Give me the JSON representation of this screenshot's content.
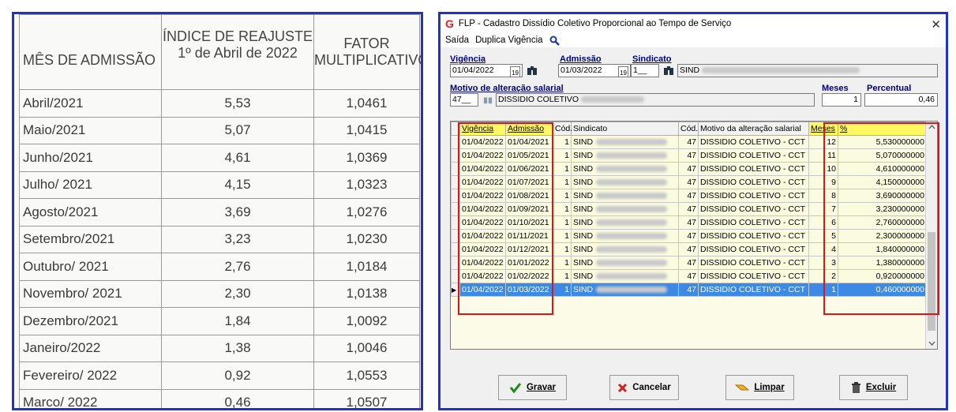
{
  "left_table": {
    "headers": [
      "MÊS DE ADMISSÃO",
      "ÍNDICE DE REAJUSTE\n1º de Abril de 2022",
      "FATOR\nMULTIPLICATIVO"
    ],
    "rows": [
      [
        "Abril/2021",
        "5,53",
        "1,0461"
      ],
      [
        "Maio/2021",
        "5,07",
        "1,0415"
      ],
      [
        "Junho/2021",
        "4,61",
        "1,0369"
      ],
      [
        "Julho/ 2021",
        "4,15",
        "1,0323"
      ],
      [
        "Agosto/2021",
        "3,69",
        "1,0276"
      ],
      [
        "Setembro/2021",
        "3,23",
        "1,0230"
      ],
      [
        "Outubro/ 2021",
        "2,76",
        "1,0184"
      ],
      [
        "Novembro/ 2021",
        "2,30",
        "1,0138"
      ],
      [
        "Dezembro/2021",
        "1,84",
        "1,0092"
      ],
      [
        "Janeiro/2022",
        "1,38",
        "1,0046"
      ],
      [
        "Fevereiro/ 2022",
        "0,92",
        "1,0553"
      ],
      [
        "Marco/ 2022",
        "0,46",
        "1,0507"
      ]
    ]
  },
  "window": {
    "title": "FLP - Cadastro Dissídio Coletivo Proporcional ao Tempo de Serviço",
    "app_icon": "G",
    "close_icon": "✕",
    "menu": {
      "saida": "Saída",
      "duplica": "Duplica Vigência",
      "search_icon": "search-icon"
    },
    "vigencia_label": "Vigência",
    "vigencia_value": "01/04/2022",
    "admissao_label": "Admissão",
    "admissao_value": "01/03/2022",
    "sindicato_label": "Sindicato",
    "sindicato_code": "1__",
    "sindicato_name": "SIND",
    "motivo_label": "Motivo de alteração salarial",
    "motivo_code": "47__",
    "motivo_name": "DISSIDIO COLETIVO",
    "meses_label": "Meses",
    "meses_value": "1",
    "percentual_label": "Percentual",
    "percentual_value": "0,46",
    "calendar_icon": "19",
    "binoculars_icon": "binoculars-icon"
  },
  "grid": {
    "columns": [
      "Vigência",
      "Admissão",
      "Cód.",
      "Sindicato",
      "Cód.",
      "Motivo da alteração salarial",
      "Meses",
      "%"
    ],
    "rows": [
      [
        "01/04/2022",
        "01/04/2021",
        "1",
        "SIND",
        "47",
        "DISSIDIO COLETIVO - CCT",
        "12",
        "5,530000000"
      ],
      [
        "01/04/2022",
        "01/05/2021",
        "1",
        "SIND",
        "47",
        "DISSIDIO COLETIVO - CCT",
        "11",
        "5,070000000"
      ],
      [
        "01/04/2022",
        "01/06/2021",
        "1",
        "SIND",
        "47",
        "DISSIDIO COLETIVO - CCT",
        "10",
        "4,610000000"
      ],
      [
        "01/04/2022",
        "01/07/2021",
        "1",
        "SIND",
        "47",
        "DISSIDIO COLETIVO - CCT",
        "9",
        "4,150000000"
      ],
      [
        "01/04/2022",
        "01/08/2021",
        "1",
        "SIND",
        "47",
        "DISSIDIO COLETIVO - CCT",
        "8",
        "3,690000000"
      ],
      [
        "01/04/2022",
        "01/09/2021",
        "1",
        "SIND",
        "47",
        "DISSIDIO COLETIVO - CCT",
        "7",
        "3,230000000"
      ],
      [
        "01/04/2022",
        "01/10/2021",
        "1",
        "SIND",
        "47",
        "DISSIDIO COLETIVO - CCT",
        "6",
        "2,760000000"
      ],
      [
        "01/04/2022",
        "01/11/2021",
        "1",
        "SIND",
        "47",
        "DISSIDIO COLETIVO - CCT",
        "5",
        "2,300000000"
      ],
      [
        "01/04/2022",
        "01/12/2021",
        "1",
        "SIND",
        "47",
        "DISSIDIO COLETIVO - CCT",
        "4",
        "1,840000000"
      ],
      [
        "01/04/2022",
        "01/01/2022",
        "1",
        "SIND",
        "47",
        "DISSIDIO COLETIVO - CCT",
        "3",
        "1,380000000"
      ],
      [
        "01/04/2022",
        "01/02/2022",
        "1",
        "SIND",
        "47",
        "DISSIDIO COLETIVO - CCT",
        "2",
        "0,920000000"
      ],
      [
        "01/04/2022",
        "01/03/2022",
        "1",
        "SIND",
        "47",
        "DISSIDIO COLETIVO - CCT",
        "1",
        "0,460000000"
      ]
    ],
    "selected_index": 11,
    "row_marker": "▶"
  },
  "buttons": {
    "gravar": "Gravar",
    "cancelar": "Cancelar",
    "limpar": "Limpar",
    "excluir": "Excluir"
  },
  "colors": {
    "frame_border": "#2132c8",
    "highlight_red": "#d81818",
    "selection": "#3d8ae6",
    "header_highlight": "#fff860",
    "grid_bg": "#fbfbe0"
  }
}
